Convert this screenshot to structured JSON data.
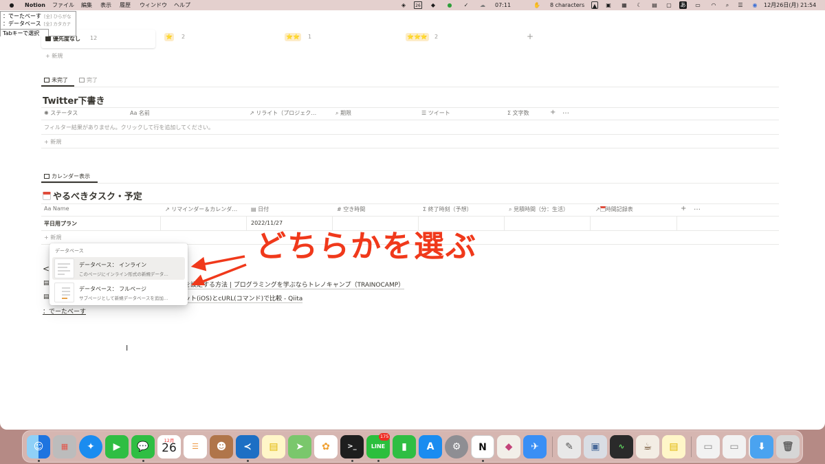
{
  "menubar": {
    "items": [
      "Notion",
      "ファイル",
      "編集",
      "表示",
      "履歴",
      "ウィンドウ",
      "ヘルプ"
    ],
    "timer": "07:11",
    "characters": "8 characters",
    "ime_mode": "あ",
    "datetime": "12月26日(月)  21:54",
    "icons": [
      "apple-icon",
      "shield-icon",
      "calendar-icon",
      "dropbox-icon",
      "chat-icon",
      "check-icon",
      "cloud-icon",
      "hand-icon",
      "lock-icon",
      "app-icon",
      "dark-mode-icon",
      "box-icon",
      "wifi-icon",
      "search-icon",
      "user-icon",
      "menu-icon"
    ]
  },
  "ime": {
    "candidates": [
      {
        "text": "：でーたべーす",
        "tag": "[全] ひらがな"
      },
      {
        "text": "：データベース",
        "tag": "[全] カタカナ"
      }
    ],
    "hint": "Tabキーで選択"
  },
  "board": {
    "card_label": "優先度なし",
    "card_count": "12",
    "group_counts": [
      "2",
      "1",
      "2"
    ],
    "star_labels": [
      "⭐",
      "⭐⭐",
      "⭐⭐⭐"
    ],
    "add_group": "+",
    "new_label": "新規"
  },
  "twitter": {
    "tabs": [
      "未完了",
      "完了"
    ],
    "title": "Twitter下書き",
    "columns": [
      "ステータス",
      "名前",
      "リライト（プロジェク…",
      "期限",
      "ツイート",
      "文字数"
    ],
    "col_prefixes": [
      "Aa"
    ],
    "more": "…",
    "empty_message": "フィルター結果がありません。クリックして行を追加してください。",
    "new_label": "新規"
  },
  "calendar": {
    "tab": "カレンダー表示",
    "title": "やるべきタスク・予定",
    "columns": [
      "Name",
      "リマインダー＆カレンダ…",
      "日付",
      "空き時間",
      "終了時刻（予想）",
      "見積時間（分：生活）",
      "時間記録表"
    ],
    "col_prefix": "Aa",
    "row_name": "平日用プラン",
    "row_date": "2022/11/27",
    "new_label": "新規"
  },
  "popup": {
    "header": "データベース",
    "options": [
      {
        "title": "データベース： インライン",
        "desc": "このページにインライン形式の新規データ…"
      },
      {
        "title": "データベース： フルページ",
        "desc": "サブページとして新規データベースを追加…"
      }
    ]
  },
  "page_lines": {
    "angle": "<",
    "line1": "を設定する方法 | プログラミングを学ぶならトレノキャンプ（TRAINOCAMP）",
    "line2": "ット(iOS)とcURL(コマンド)で比較 - Qiita",
    "typed": "：でーたべーす"
  },
  "annotation": {
    "text": "どちらかを選ぶ",
    "color": "#f0391b"
  },
  "dock": {
    "calendar_month": "12月",
    "calendar_day": "26",
    "line_badge": "175",
    "apps": [
      "finder",
      "launchpad",
      "safari",
      "facetime",
      "messages",
      "calendar",
      "reminders",
      "contacts",
      "vscode",
      "notes",
      "maps",
      "photos",
      "terminal",
      "line",
      "numbers",
      "app-store",
      "system-preferences",
      "notion",
      "affinity",
      "testflight",
      "script-editor",
      "preview",
      "activity-monitor",
      "coffee",
      "notes-2",
      "downloads",
      "trash"
    ]
  }
}
